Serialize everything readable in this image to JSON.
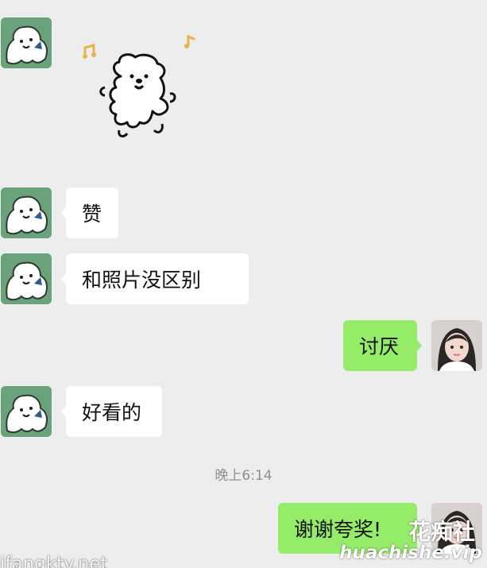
{
  "messages": {
    "zan": "赞",
    "photo_compare": "和照片没区别",
    "taoyan": "讨厌",
    "haokan": "好看的",
    "xiexie": "谢谢夸奖!"
  },
  "timestamp": "晚上6:14",
  "watermarks": {
    "site_cn": "花痴社",
    "site_url": "huachishe.vip",
    "site_left": "ifangkty.net"
  },
  "icons": {
    "other_avatar": "cartoon-dog-avatar-icon",
    "self_avatar": "girl-photo-avatar-icon",
    "sticker": "dancing-bear-sticker"
  },
  "colors": {
    "background": "#ededed",
    "self_bubble": "#95ec69",
    "other_bubble": "#ffffff",
    "other_avatar_bg": "#6aa37b"
  }
}
